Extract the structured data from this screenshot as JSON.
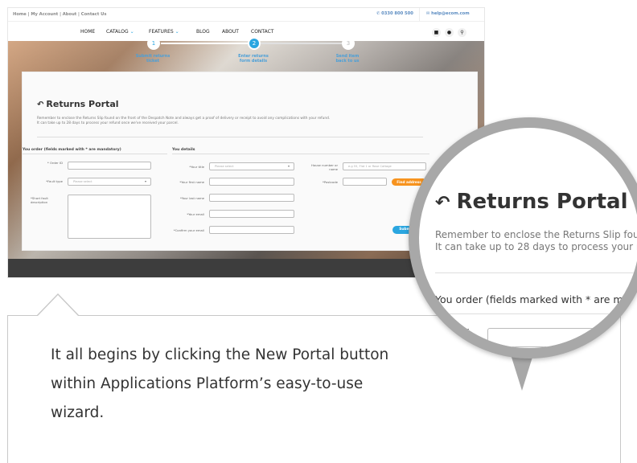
{
  "topbar": {
    "links": "Home | My Account | About | Contact Us",
    "phone": "0330 800 500",
    "email": "help@ecom.com"
  },
  "nav": {
    "home": "HOME",
    "catalog": "CATALOG",
    "features": "FEATURES",
    "blog": "BLOG",
    "about": "ABOUT",
    "contact": "CONTACT",
    "icons": [
      "cart-icon",
      "user-icon",
      "search-icon"
    ]
  },
  "steps": [
    {
      "number": "1",
      "label_line1": "Submit returns",
      "label_line2": "ticket"
    },
    {
      "number": "2",
      "label_line1": "Enter returns",
      "label_line2": "form details"
    },
    {
      "number": "3",
      "label_line1": "Send item",
      "label_line2": "back to us"
    }
  ],
  "portal": {
    "title": "Returns Portal",
    "desc_line1": "Remember to enclose the Returns Slip found on the front of the Despatch Note and always get a proof of delivery or receipt to avoid any complications with your refund.",
    "desc_line2": "It can take up to 28 days to process your refund once we've received your parcel."
  },
  "order": {
    "heading": "You order (fields marked with * are mandatory)",
    "order_id_label": "* Order ID",
    "fault_type_label": "*Fault type",
    "fault_type_value": "Please select",
    "fault_desc_label": "*Short fault description"
  },
  "details": {
    "heading": "You details",
    "title_label": "*Your title",
    "title_value": "Please select",
    "first_name_label": "*Your first name",
    "last_name_label": "*Your last name",
    "email_label": "*Your email",
    "confirm_email_label": "*Confirm your email",
    "house_label": "House number or name",
    "house_placeholder": "e.g 55, Flat 1 or Rose Cottage",
    "postcode_label": "*Postcode",
    "find_address": "Find address",
    "submit": "Submit"
  },
  "lens": {
    "title": "Returns Portal",
    "desc_line1": "Remember to enclose the Returns Slip found o",
    "desc_line2": "It can take up to 28 days to process your refun",
    "section": "You order (fields marked with * are mandato",
    "order_label": "Order ID"
  },
  "callout": {
    "text": "It all begins by clicking the New Portal button within Applications Platform’s easy-to-use wizard."
  },
  "colors": {
    "accent_blue": "#2aa6e0",
    "accent_orange": "#f7931e",
    "lens_ring": "#a8a8a8"
  }
}
